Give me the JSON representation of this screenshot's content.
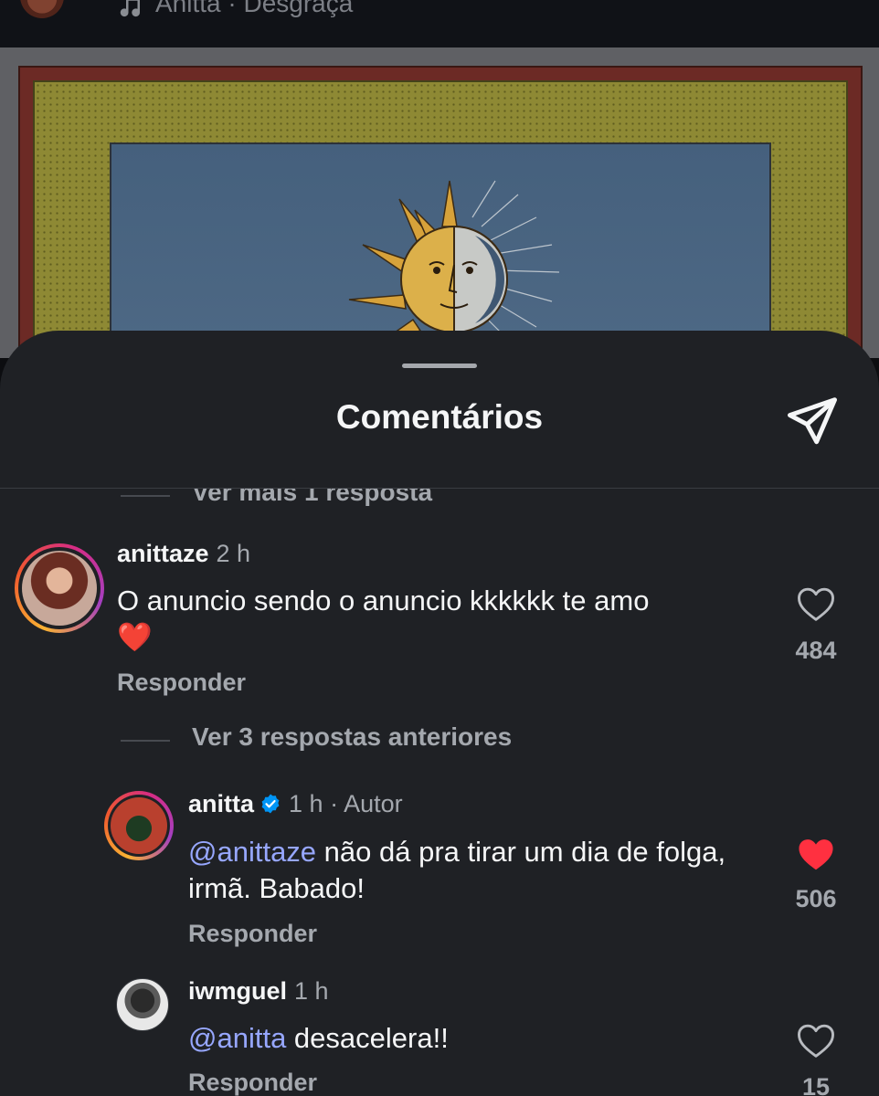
{
  "post": {
    "music_label": "Anitta · Desgraça",
    "music_icon": "music-note-icon"
  },
  "sheet": {
    "title": "Comentários",
    "share_icon": "send-paper-plane-icon"
  },
  "comments": {
    "top_view_more": "Ver mais 1 resposta",
    "c1": {
      "user": "anittaze",
      "time": "2 h",
      "text": "O anuncio sendo o anuncio kkkkkk te amo",
      "emoji": "❤️",
      "reply_label": "Responder",
      "likes": "484",
      "liked": false
    },
    "view_previous": "Ver 3 respostas anteriores",
    "c2": {
      "user": "anitta",
      "time": "1 h",
      "separator": "·",
      "author_label": "Autor",
      "mention": "@anittaze",
      "text": " não dá pra tirar um dia de folga, irmã. Babado!",
      "reply_label": "Responder",
      "likes": "506",
      "liked": true
    },
    "c3": {
      "user": "iwmguel",
      "time": "1 h",
      "mention": "@anitta",
      "text": " desacelera!!",
      "reply_label": "Responder",
      "likes": "15",
      "liked": false
    }
  },
  "colors": {
    "sheet_bg": "#1f2125",
    "mention": "#97a7ff",
    "like_red": "#ff3040",
    "verified_blue": "#0095f6"
  }
}
